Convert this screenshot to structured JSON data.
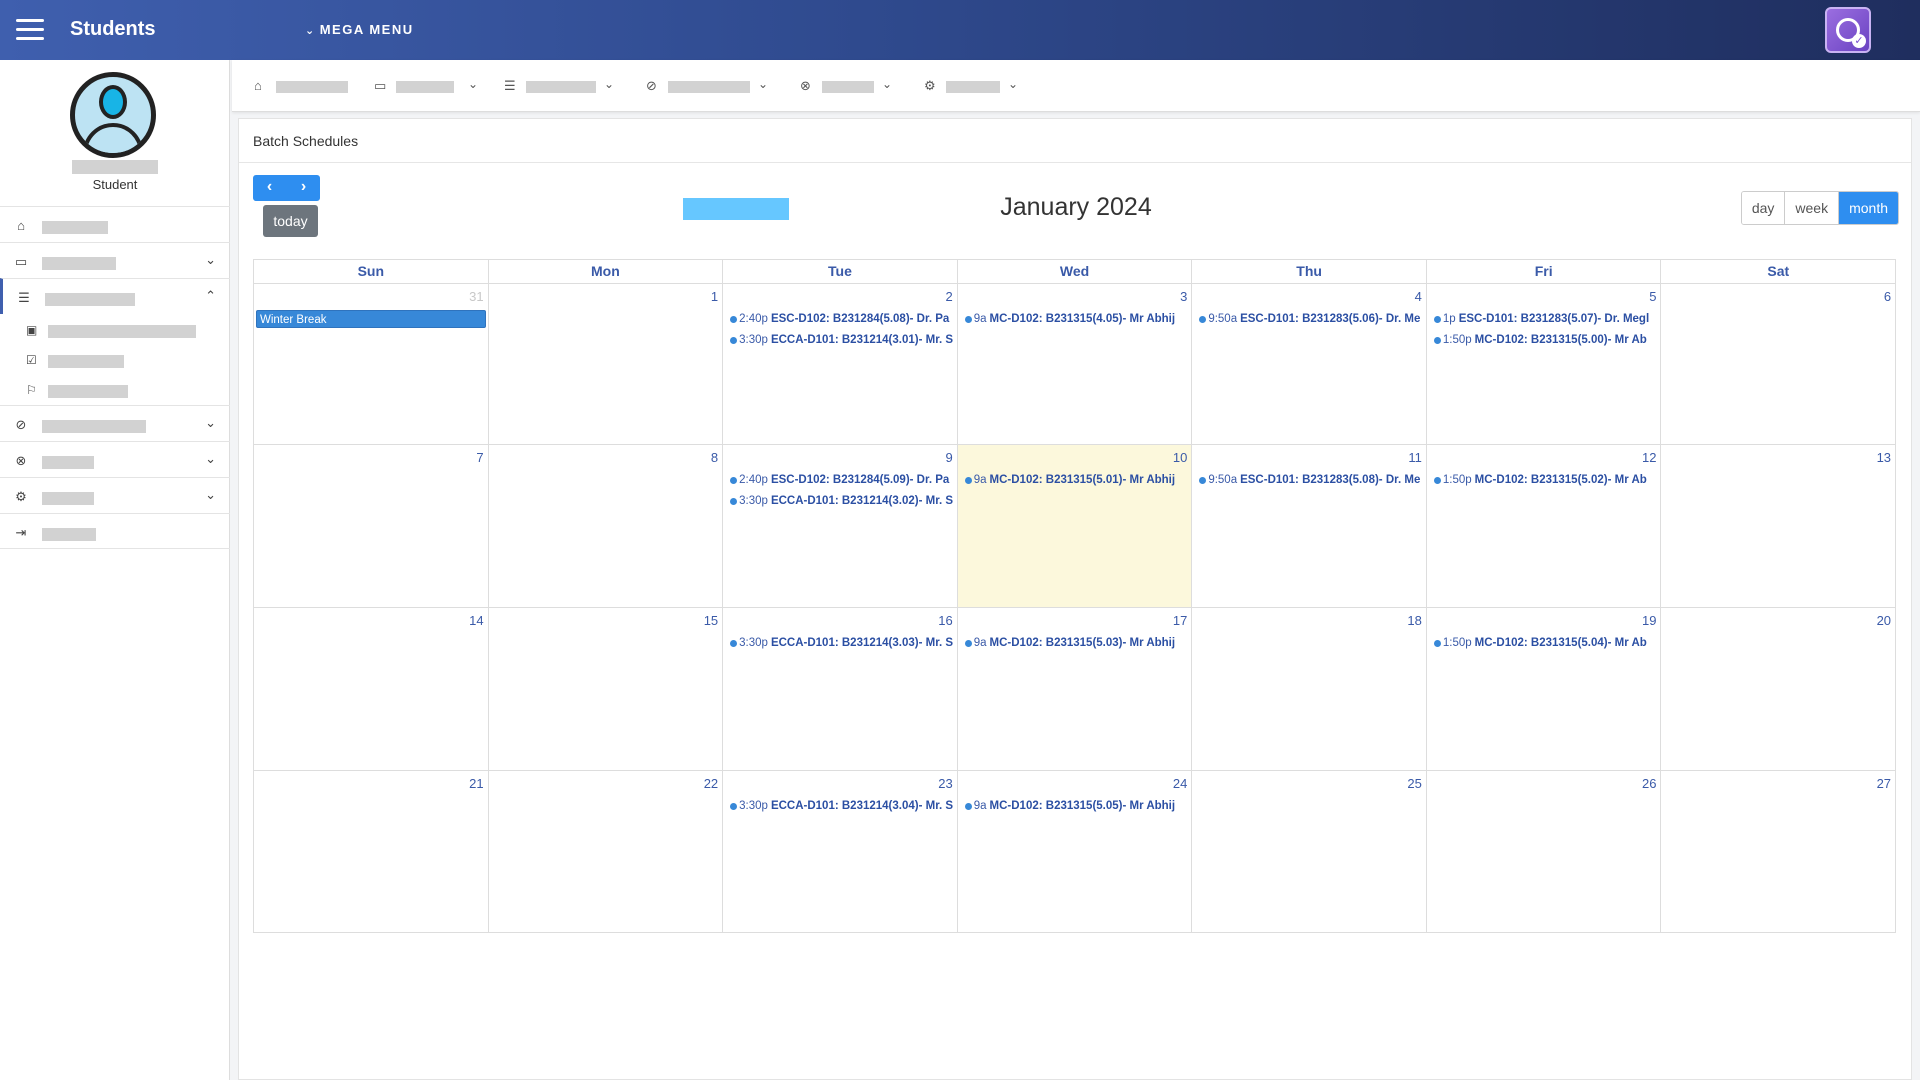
{
  "header": {
    "app_title": "Students",
    "mega_menu": "MEGA MENU"
  },
  "sidebar": {
    "role": "Student",
    "items": [
      {
        "key": "home",
        "icon": "⌂"
      },
      {
        "key": "payments",
        "icon": "▭",
        "caret": "⌄"
      },
      {
        "key": "academics",
        "icon": "☰",
        "caret": "⌃"
      },
      {
        "key": "explore",
        "icon": "⊘",
        "caret": "⌄"
      },
      {
        "key": "cancel",
        "icon": "⊗",
        "caret": "⌄"
      },
      {
        "key": "settings",
        "icon": "⚙",
        "caret": "⌄"
      },
      {
        "key": "logout",
        "icon": "⇥"
      }
    ]
  },
  "card": {
    "title": "Batch Schedules"
  },
  "calendar": {
    "title": "January 2024",
    "today_label": "today",
    "prev_icon": "‹",
    "next_icon": "›",
    "views": [
      "day",
      "week",
      "month"
    ],
    "active_view": "month",
    "days_of_week": [
      "Sun",
      "Mon",
      "Tue",
      "Wed",
      "Thu",
      "Fri",
      "Sat"
    ],
    "today_date": 10,
    "weeks": [
      [
        {
          "num": "31",
          "other": true,
          "events": [
            {
              "kind": "block",
              "title": "Winter Break"
            }
          ]
        },
        {
          "num": "1",
          "events": []
        },
        {
          "num": "2",
          "events": [
            {
              "time": "2:40p",
              "title": "ESC-D102: B231284(5.08)- Dr. Pa"
            },
            {
              "time": "3:30p",
              "title": "ECCA-D101: B231214(3.01)- Mr. S"
            }
          ]
        },
        {
          "num": "3",
          "events": [
            {
              "time": "9a",
              "title": "MC-D102: B231315(4.05)- Mr Abhij"
            }
          ]
        },
        {
          "num": "4",
          "events": [
            {
              "time": "9:50a",
              "title": "ESC-D101: B231283(5.06)- Dr. Me"
            }
          ]
        },
        {
          "num": "5",
          "events": [
            {
              "time": "1p",
              "title": "ESC-D101: B231283(5.07)- Dr. Megl"
            },
            {
              "time": "1:50p",
              "title": "MC-D102: B231315(5.00)- Mr Ab"
            }
          ]
        },
        {
          "num": "6",
          "events": []
        }
      ],
      [
        {
          "num": "7",
          "events": []
        },
        {
          "num": "8",
          "events": []
        },
        {
          "num": "9",
          "events": [
            {
              "time": "2:40p",
              "title": "ESC-D102: B231284(5.09)- Dr. Pa"
            },
            {
              "time": "3:30p",
              "title": "ECCA-D101: B231214(3.02)- Mr. S"
            }
          ]
        },
        {
          "num": "10",
          "today": true,
          "events": [
            {
              "time": "9a",
              "title": "MC-D102: B231315(5.01)- Mr Abhij"
            }
          ]
        },
        {
          "num": "11",
          "events": [
            {
              "time": "9:50a",
              "title": "ESC-D101: B231283(5.08)- Dr. Me"
            }
          ]
        },
        {
          "num": "12",
          "events": [
            {
              "time": "1:50p",
              "title": "MC-D102: B231315(5.02)- Mr Ab"
            }
          ]
        },
        {
          "num": "13",
          "events": []
        }
      ],
      [
        {
          "num": "14",
          "events": []
        },
        {
          "num": "15",
          "events": []
        },
        {
          "num": "16",
          "events": [
            {
              "time": "3:30p",
              "title": "ECCA-D101: B231214(3.03)- Mr. S"
            }
          ]
        },
        {
          "num": "17",
          "events": [
            {
              "time": "9a",
              "title": "MC-D102: B231315(5.03)- Mr Abhij"
            }
          ]
        },
        {
          "num": "18",
          "events": []
        },
        {
          "num": "19",
          "events": [
            {
              "time": "1:50p",
              "title": "MC-D102: B231315(5.04)- Mr Ab"
            }
          ]
        },
        {
          "num": "20",
          "events": []
        }
      ],
      [
        {
          "num": "21",
          "events": []
        },
        {
          "num": "22",
          "events": []
        },
        {
          "num": "23",
          "events": [
            {
              "time": "3:30p",
              "title": "ECCA-D101: B231214(3.04)- Mr. S"
            }
          ]
        },
        {
          "num": "24",
          "events": [
            {
              "time": "9a",
              "title": "MC-D102: B231315(5.05)- Mr Abhij"
            }
          ]
        },
        {
          "num": "25",
          "events": []
        },
        {
          "num": "26",
          "events": []
        },
        {
          "num": "27",
          "events": []
        }
      ]
    ]
  },
  "colors": {
    "accent": "#2e8ef0",
    "event_dot": "#3788d8",
    "today_bg": "#fcf8dc",
    "header_start": "#3f5fae",
    "header_end": "#1f2e5e"
  }
}
